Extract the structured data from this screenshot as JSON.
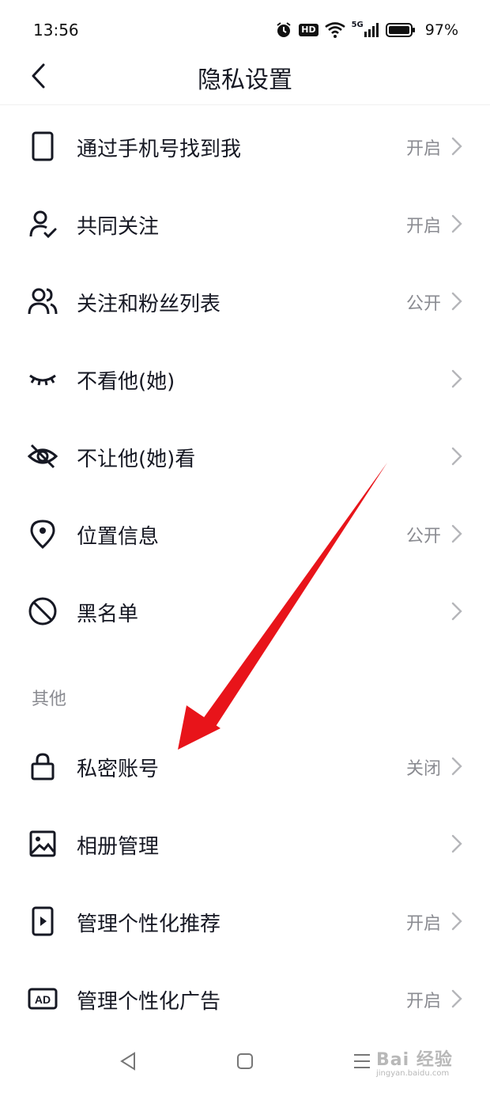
{
  "status": {
    "time": "13:56",
    "network": "5G",
    "hd": "HD",
    "battery": "97%"
  },
  "header": {
    "title": "隐私设置"
  },
  "items": [
    {
      "label": "通过手机号找到我",
      "value": "开启",
      "icon": "phone-icon"
    },
    {
      "label": "共同关注",
      "value": "开启",
      "icon": "mutual-follow-icon"
    },
    {
      "label": "关注和粉丝列表",
      "value": "公开",
      "icon": "users-icon"
    },
    {
      "label": "不看他(她)",
      "value": "",
      "icon": "closed-eye-icon"
    },
    {
      "label": "不让他(她)看",
      "value": "",
      "icon": "eye-off-icon"
    },
    {
      "label": "位置信息",
      "value": "公开",
      "icon": "location-pin-icon"
    },
    {
      "label": "黑名单",
      "value": "",
      "icon": "block-icon"
    }
  ],
  "section_other": "其他",
  "other_items": [
    {
      "label": "私密账号",
      "value": "关闭",
      "icon": "lock-icon"
    },
    {
      "label": "相册管理",
      "value": "",
      "icon": "image-icon"
    },
    {
      "label": "管理个性化推荐",
      "value": "开启",
      "icon": "video-phone-icon"
    },
    {
      "label": "管理个性化广告",
      "value": "开启",
      "icon": "ad-icon"
    }
  ],
  "watermark": {
    "brand": "Bai 经验",
    "url": "jingyan.baidu.com"
  },
  "colors": {
    "text": "#161823",
    "secondary": "#8a8b91",
    "arrow": "#e8141a"
  }
}
